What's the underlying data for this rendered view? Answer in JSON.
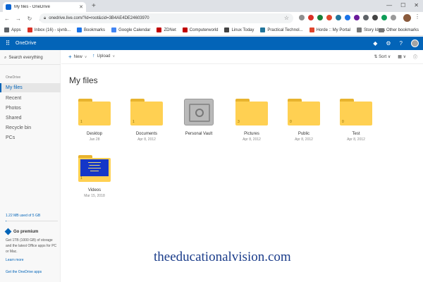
{
  "browser": {
    "tab_title": "My files - OneDrive",
    "url": "onedrive.live.com/?id=root&cid=3B4AE4DE24603970",
    "bookmarks": [
      {
        "label": "Apps",
        "color": "#5f6368"
      },
      {
        "label": "Inbox (16) - sjvnb...",
        "color": "#d93025"
      },
      {
        "label": "Bookmarks",
        "color": "#1a73e8"
      },
      {
        "label": "Google Calendar",
        "color": "#4285f4"
      },
      {
        "label": "ZDNet",
        "color": "#c00000"
      },
      {
        "label": "Computerworld",
        "color": "#c00000"
      },
      {
        "label": "Linux Today",
        "color": "#444444"
      },
      {
        "label": "Practical Technol...",
        "color": "#21759b"
      },
      {
        "label": "Horde :: My Portal",
        "color": "#e0452c"
      },
      {
        "label": "Story Ideas",
        "color": "#777777"
      }
    ],
    "other_bookmarks": "Other bookmarks"
  },
  "onedrive": {
    "brand": "OneDrive",
    "accent": "#0364b8"
  },
  "sidebar": {
    "search_placeholder": "Search everything",
    "section_heading": "OneDrive",
    "items": [
      {
        "label": "My files",
        "active": true
      },
      {
        "label": "Recent",
        "active": false
      },
      {
        "label": "Photos",
        "active": false
      },
      {
        "label": "Shared",
        "active": false
      },
      {
        "label": "Recycle bin",
        "active": false
      },
      {
        "label": "PCs",
        "active": false
      }
    ],
    "storage_text": "1.22 MB used of 5 GB",
    "storage_fraction": 0.0002,
    "premium_title": "Go premium",
    "premium_text": "Get 1TB (1000 GB) of storage and the latest Office apps for PC or Mac.",
    "learn_more": "Learn more",
    "get_apps": "Get the OneDrive apps"
  },
  "command_bar": {
    "new_label": "New",
    "upload_label": "Upload",
    "sort_label": "Sort"
  },
  "main": {
    "title": "My files",
    "tiles": [
      {
        "name": "Desktop",
        "date": "Jan 28",
        "count": "1",
        "kind": "folder"
      },
      {
        "name": "Documents",
        "date": "Apr 8, 2012",
        "count": "1",
        "kind": "folder"
      },
      {
        "name": "Personal Vault",
        "date": "",
        "count": "",
        "kind": "vault"
      },
      {
        "name": "Pictures",
        "date": "Apr 8, 2012",
        "count": "3",
        "kind": "folder"
      },
      {
        "name": "Public",
        "date": "Apr 8, 2012",
        "count": "0",
        "kind": "folder"
      },
      {
        "name": "Test",
        "date": "Apr 8, 2012",
        "count": "0",
        "kind": "folder"
      },
      {
        "name": "Videos",
        "date": "Mar 15, 2018",
        "count": "1",
        "kind": "video"
      }
    ]
  },
  "watermark": "theeducationalvision.com"
}
